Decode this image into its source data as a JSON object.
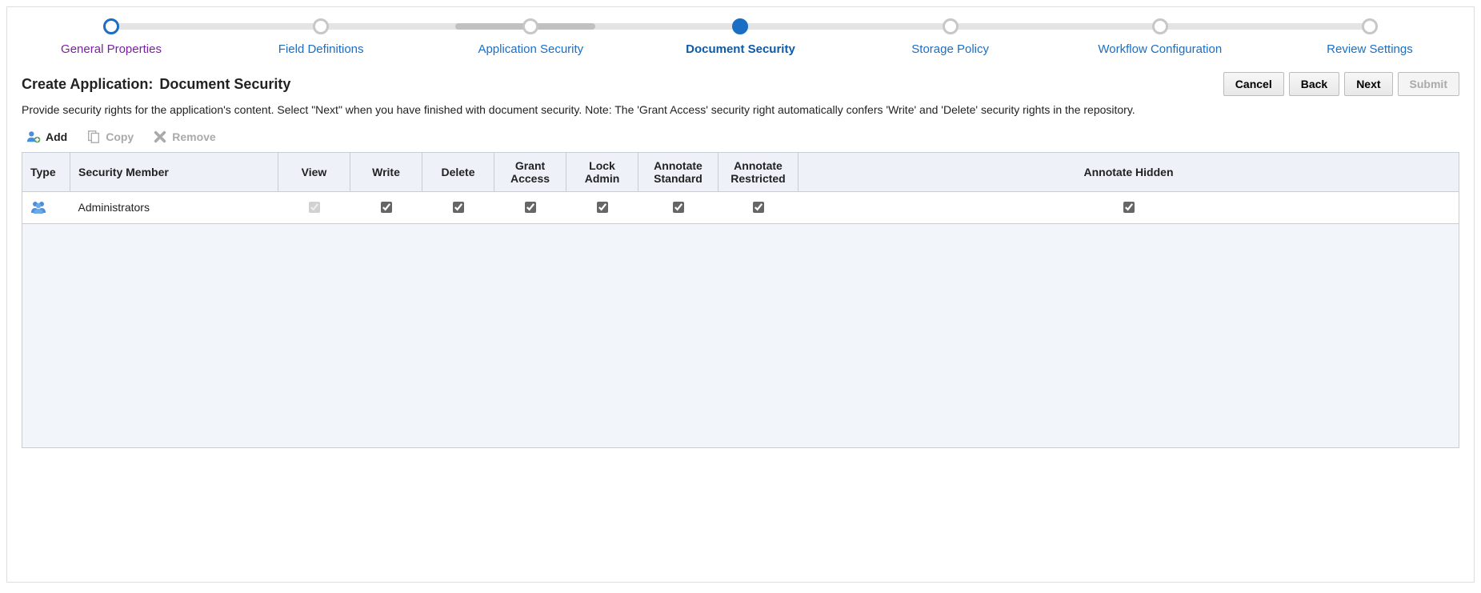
{
  "wizard_steps": [
    {
      "label": "General Properties",
      "state": "visited"
    },
    {
      "label": "Field Definitions",
      "state": "normal"
    },
    {
      "label": "Application Security",
      "state": "normal"
    },
    {
      "label": "Document Security",
      "state": "current"
    },
    {
      "label": "Storage Policy",
      "state": "normal"
    },
    {
      "label": "Workflow Configuration",
      "state": "normal"
    },
    {
      "label": "Review Settings",
      "state": "normal"
    }
  ],
  "heading": {
    "prefix": "Create Application:",
    "title": "Document Security"
  },
  "buttons": {
    "cancel": "Cancel",
    "back": "Back",
    "next": "Next",
    "submit": "Submit"
  },
  "description": "Provide security rights for the application's content. Select \"Next\" when you have finished with document security. Note: The 'Grant Access' security right automatically confers 'Write' and 'Delete' security rights in the repository.",
  "toolbar": {
    "add": "Add",
    "copy": "Copy",
    "remove": "Remove"
  },
  "table": {
    "headers": {
      "type": "Type",
      "member": "Security Member",
      "view": "View",
      "write": "Write",
      "delete": "Delete",
      "grant": "Grant Access",
      "lock": "Lock Admin",
      "ann_std": "Annotate Standard",
      "ann_res": "Annotate Restricted",
      "ann_hid": "Annotate Hidden"
    },
    "rows": [
      {
        "member": "Administrators",
        "view": true,
        "view_disabled": true,
        "write": true,
        "delete": true,
        "grant": true,
        "lock": true,
        "ann_std": true,
        "ann_res": true,
        "ann_hid": true
      }
    ]
  }
}
